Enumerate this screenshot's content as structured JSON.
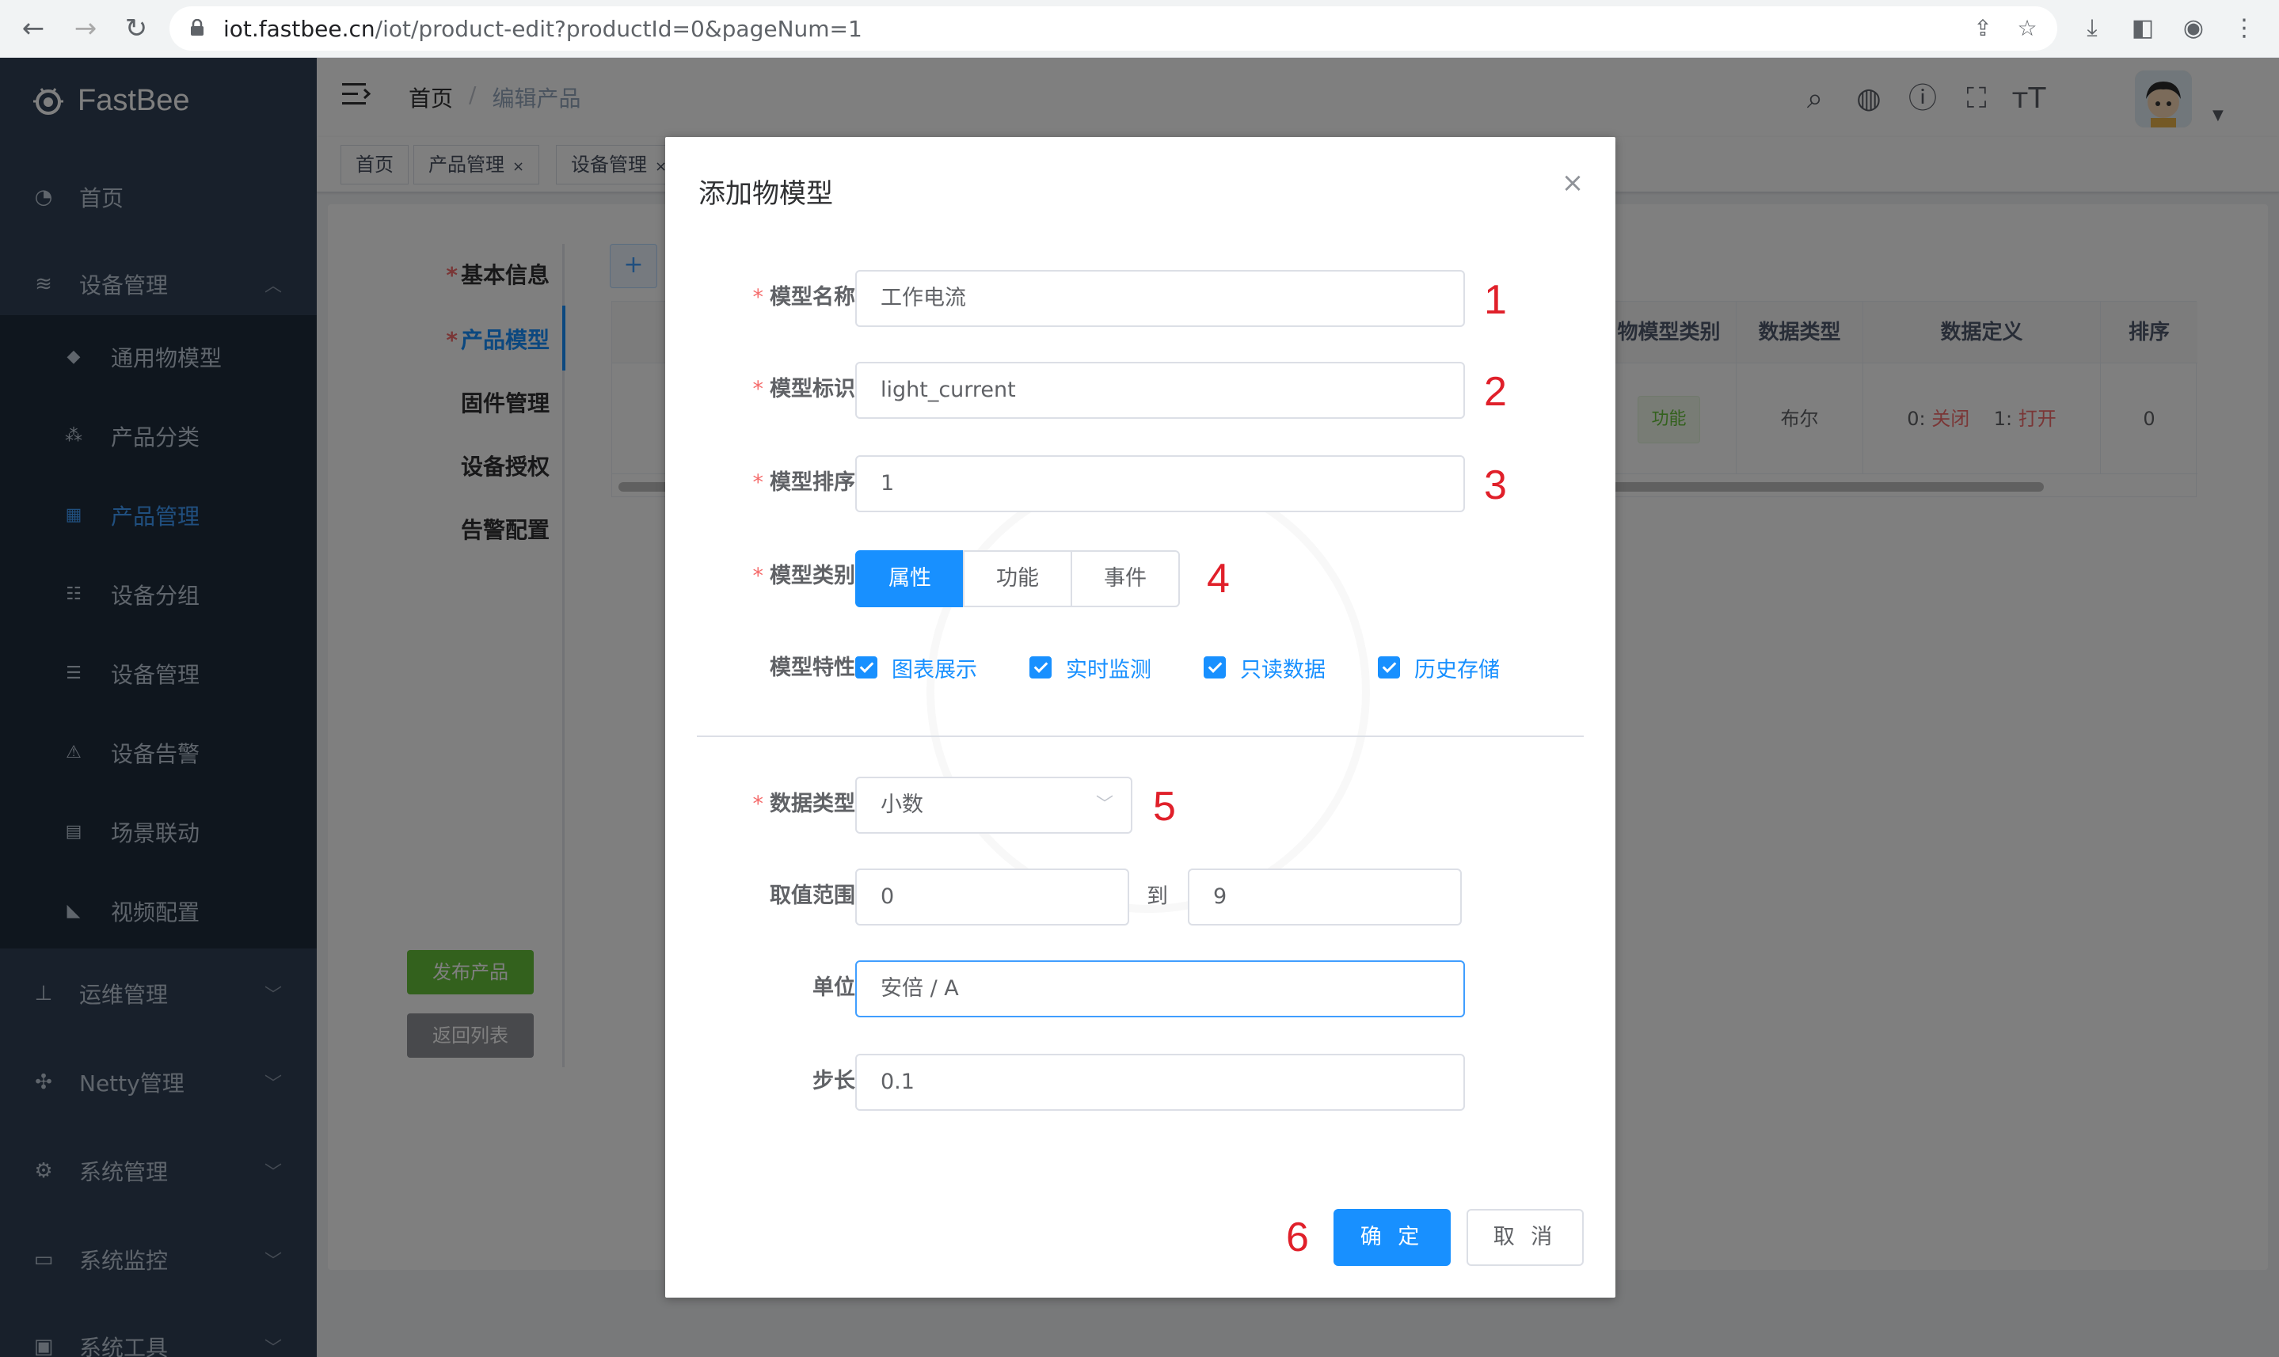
{
  "browser": {
    "url_host": "iot.fastbee.cn",
    "url_path": "/iot/product-edit?productId=0&pageNum=1"
  },
  "sidebar": {
    "logo": "FastBee",
    "items": [
      {
        "label": "首页",
        "icon": "dashboard-icon"
      },
      {
        "label": "设备管理",
        "icon": "device-icon"
      },
      {
        "label": "运维管理",
        "icon": "ops-icon"
      },
      {
        "label": "Netty管理",
        "icon": "netty-icon"
      },
      {
        "label": "系统管理",
        "icon": "gear-icon"
      },
      {
        "label": "系统监控",
        "icon": "monitor-icon"
      },
      {
        "label": "系统工具",
        "icon": "tool-icon"
      }
    ],
    "sub_items": [
      {
        "label": "通用物模型",
        "icon": "cube-icon"
      },
      {
        "label": "产品分类",
        "icon": "tree-icon"
      },
      {
        "label": "产品管理",
        "icon": "grid-icon"
      },
      {
        "label": "设备分组",
        "icon": "group-icon"
      },
      {
        "label": "设备管理",
        "icon": "server-icon"
      },
      {
        "label": "设备告警",
        "icon": "alarm-icon"
      },
      {
        "label": "场景联动",
        "icon": "scene-icon"
      },
      {
        "label": "视频配置",
        "icon": "camera-icon"
      }
    ]
  },
  "navbar": {
    "breadcrumb_home": "首页",
    "breadcrumb_sep": "/",
    "breadcrumb_current": "编辑产品"
  },
  "tags": [
    {
      "label": "首页"
    },
    {
      "label": "产品管理"
    },
    {
      "label": "设备管理"
    }
  ],
  "product_tabs": [
    {
      "label": "基本信息",
      "required": true
    },
    {
      "label": "产品模型",
      "required": true
    },
    {
      "label": "固件管理",
      "required": false
    },
    {
      "label": "设备授权",
      "required": false
    },
    {
      "label": "告警配置",
      "required": false
    }
  ],
  "product_buttons": {
    "publish": "发布产品",
    "back": "返回列表",
    "add": "+"
  },
  "table": {
    "headers": [
      "物模型类别",
      "数据类型",
      "数据定义",
      "排序"
    ],
    "row": {
      "category": "功能",
      "data_type": "布尔",
      "def_0_key": "0:",
      "def_0_val": "关闭",
      "def_1_key": "1:",
      "def_1_val": "打开",
      "sort": "0"
    }
  },
  "dialog": {
    "title": "添加物模型",
    "close": "×",
    "required_mark": "*",
    "labels": {
      "name": "模型名称",
      "identifier": "模型标识",
      "order": "模型排序",
      "category": "模型类别",
      "features": "模型特性",
      "data_type": "数据类型",
      "range": "取值范围",
      "unit": "单位",
      "step": "步长"
    },
    "values": {
      "name": "工作电流",
      "identifier": "light_current",
      "order": "1",
      "data_type": "小数",
      "range_min": "0",
      "range_max": "9",
      "unit": "安倍 / A",
      "step": "0.1"
    },
    "range_to": "到",
    "category_options": [
      {
        "label": "属性",
        "selected": true
      },
      {
        "label": "功能",
        "selected": false
      },
      {
        "label": "事件",
        "selected": false
      }
    ],
    "features": [
      {
        "label": "图表展示",
        "checked": true
      },
      {
        "label": "实时监测",
        "checked": true
      },
      {
        "label": "只读数据",
        "checked": true
      },
      {
        "label": "历史存储",
        "checked": true
      }
    ],
    "confirm": "确 定",
    "cancel": "取 消",
    "annotations": [
      "1",
      "2",
      "3",
      "4",
      "5",
      "6"
    ]
  },
  "colors": {
    "primary": "#1890ff",
    "sidebar_bg": "#304156",
    "submenu_bg": "#1f2d3d",
    "success": "#67c23a",
    "danger": "#f56c6c",
    "annotation": "#e0202a"
  }
}
